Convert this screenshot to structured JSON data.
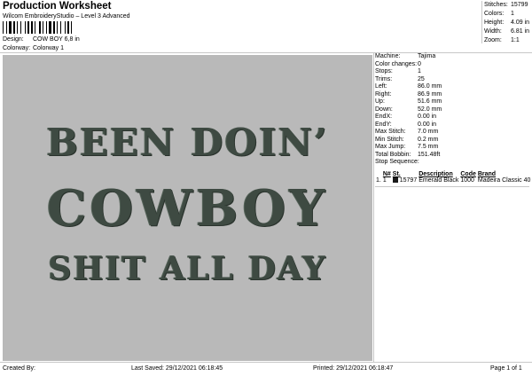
{
  "header": {
    "title": "Production Worksheet",
    "subtitle": "Wilcom EmbroideryStudio – Level 3 Advanced",
    "design_label": "Design:",
    "design_value": "COW BOY  6,8 in",
    "colorway_label": "Colorway:",
    "colorway_value": "Colorway 1"
  },
  "stats": [
    {
      "label": "Stitches:",
      "value": "15799"
    },
    {
      "label": "Colors:",
      "value": "1"
    },
    {
      "label": "Height:",
      "value": "4.09 in"
    },
    {
      "label": "Width:",
      "value": "6.81 in"
    },
    {
      "label": "Zoom:",
      "value": "1:1"
    }
  ],
  "design": {
    "line1": "BEEN DOIN’",
    "line2": "COWBOY",
    "line3": "SHIT ALL DAY",
    "thread_color": "#3e4a42",
    "background": "#b9b9b9"
  },
  "machine_info": [
    {
      "label": "Machine:",
      "value": "Tajima"
    },
    {
      "label": "Color changes:",
      "value": "0"
    },
    {
      "label": "Stops:",
      "value": "1"
    },
    {
      "label": "Trims:",
      "value": "25"
    },
    {
      "label": "Left:",
      "value": "86.0 mm"
    },
    {
      "label": "Right:",
      "value": "86.9 mm"
    },
    {
      "label": "Up:",
      "value": "51.6 mm"
    },
    {
      "label": "Down:",
      "value": "52.0 mm"
    },
    {
      "label": "EndX:",
      "value": "0.00 in"
    },
    {
      "label": "EndY:",
      "value": "0.00 in"
    },
    {
      "label": "Max Stitch:",
      "value": "7.0 mm"
    },
    {
      "label": "Min Stitch:",
      "value": "0.2 mm"
    },
    {
      "label": "Max Jump:",
      "value": "7.5 mm"
    },
    {
      "label": "Total Bobbin:",
      "value": "151.48ft"
    }
  ],
  "stop_sequence": {
    "title": "Stop Sequence:",
    "headers": {
      "n": "N#",
      "st": "St.",
      "description": "Description",
      "code": "Code",
      "brand": "Brand"
    },
    "rows": [
      {
        "idx": "1.",
        "n": "1",
        "st": "15797",
        "description": "Emerald Black",
        "code": "1000",
        "brand": "Madeira Classic 40",
        "color": "#1a1a1a"
      }
    ]
  },
  "footer": {
    "created_by": "Created By:",
    "last_saved": "Last Saved: 29/12/2021 06:18:45",
    "printed": "Printed: 29/12/2021 06:18:47",
    "page": "Page 1 of 1"
  }
}
